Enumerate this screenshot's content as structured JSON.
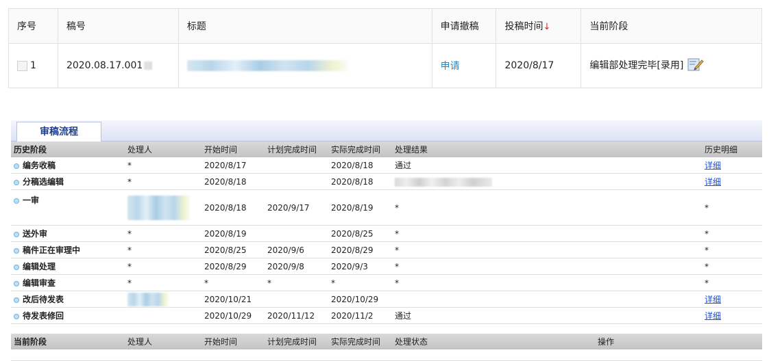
{
  "manuscript_table": {
    "headers": [
      "序号",
      "稿号",
      "标题",
      "申请撤稿",
      "投稿时间",
      "当前阶段"
    ],
    "sort_arrow": "↓",
    "row": {
      "index": "1",
      "manuscript_no": "2020.08.17.001",
      "withdraw_link": "申请",
      "submit_date": "2020/8/17",
      "stage": "编辑部处理完毕[录用]"
    }
  },
  "flow": {
    "tab_label": "审稿流程",
    "history_headers": [
      "历史阶段",
      "处理人",
      "开始时间",
      "计划完成时间",
      "实际完成时间",
      "处理结果",
      "历史明细"
    ],
    "history_rows": [
      {
        "stage": "编务收稿",
        "handler": "*",
        "start": "2020/8/17",
        "plan": "",
        "actual": "2020/8/18",
        "result": "通过",
        "detail": "详细"
      },
      {
        "stage": "分稿选编辑",
        "handler": "*",
        "start": "2020/8/18",
        "plan": "",
        "actual": "2020/8/18",
        "result": "",
        "detail": "详细"
      },
      {
        "stage": "一审",
        "handler": "",
        "start": "2020/8/18",
        "plan": "2020/9/17",
        "actual": "2020/8/19",
        "result": "*",
        "detail": "*"
      },
      {
        "stage": "送外审",
        "handler": "*",
        "start": "2020/8/19",
        "plan": "",
        "actual": "2020/8/25",
        "result": "*",
        "detail": "*"
      },
      {
        "stage": "稿件正在审理中",
        "handler": "*",
        "start": "2020/8/25",
        "plan": "2020/9/6",
        "actual": "2020/8/29",
        "result": "*",
        "detail": "*"
      },
      {
        "stage": "编辑处理",
        "handler": "*",
        "start": "2020/8/29",
        "plan": "2020/9/8",
        "actual": "2020/9/3",
        "result": "*",
        "detail": "*"
      },
      {
        "stage": "编辑审查",
        "handler": "*",
        "start": "*",
        "plan": "*",
        "actual": "*",
        "result": "*",
        "detail": "*"
      },
      {
        "stage": "改后待发表",
        "handler": "",
        "start": "2020/10/21",
        "plan": "",
        "actual": "2020/10/29",
        "result": "",
        "detail": "详细"
      },
      {
        "stage": "待发表修回",
        "handler": "",
        "start": "2020/10/29",
        "plan": "2020/11/12",
        "actual": "2020/11/2",
        "result": "通过",
        "detail": "详细"
      }
    ],
    "current_headers": [
      "当前阶段",
      "处理人",
      "开始时间",
      "计划完成时间",
      "实际完成时间",
      "处理状态",
      "操作"
    ]
  }
}
